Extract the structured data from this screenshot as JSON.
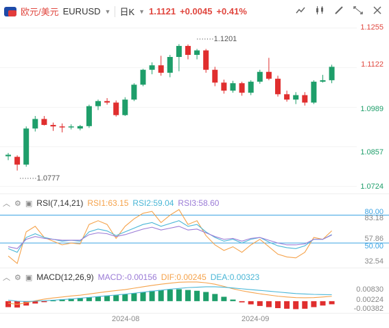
{
  "header": {
    "pair_cn": "欧元/美元",
    "symbol": "EURUSD",
    "timeframe": "日K",
    "price": "1.1121",
    "change": "+0.0045",
    "change_pct": "+0.41%",
    "tool_icons": [
      "line-chart-icon",
      "candle-type-icon",
      "draw-tool-icon",
      "expand-icon",
      "close-icon"
    ]
  },
  "price_axis": {
    "labels": [
      "1.1255",
      "1.1122",
      "1.0989",
      "1.0857",
      "1.0724"
    ],
    "current_tag": "1.1122",
    "high_label": "1.1201",
    "low_label": "1.0777"
  },
  "rsi": {
    "title": "RSI(7,14,21)",
    "rsi1": "RSI1:63.15",
    "rsi2": "RSI2:59.04",
    "rsi3": "RSI3:58.60",
    "axis": [
      "80.00",
      "83.18",
      "57.86",
      "50.00",
      "32.54"
    ]
  },
  "macd": {
    "title": "MACD(12,26,9)",
    "macd": "MACD:-0.00156",
    "dif": "DIF:0.00245",
    "dea": "DEA:0.00323",
    "axis": [
      "0.00830",
      "0.00224",
      "-0.00382"
    ]
  },
  "x_axis": [
    "2024-08",
    "2024-09"
  ],
  "colors": {
    "up": "#e02e2e",
    "down": "#1e9e6a",
    "rsi1": "#f5a24a",
    "rsi2": "#49b6d6",
    "rsi3": "#9a7ad6",
    "dif": "#f5a24a",
    "dea": "#49b6d6",
    "ref_line": "#3aa3e3"
  },
  "chart_data": [
    {
      "type": "candlestick",
      "series": [
        {
          "name": "EURUSD",
          "ohlc": [
            [
              1.0825,
              1.0836,
              1.0812,
              1.083
            ],
            [
              1.0823,
              1.0828,
              1.0777,
              1.0797
            ],
            [
              1.0797,
              1.0925,
              1.079,
              1.0918
            ],
            [
              1.0918,
              1.096,
              1.0908,
              1.095
            ],
            [
              1.095,
              1.096,
              1.0928,
              1.093
            ],
            [
              1.093,
              1.0938,
              1.091,
              1.0925
            ],
            [
              1.0925,
              1.0935,
              1.0905,
              1.0922
            ],
            [
              1.0922,
              1.0932,
              1.0915,
              1.0925
            ],
            [
              1.0918,
              1.093,
              1.0912,
              1.0926
            ],
            [
              1.0926,
              1.0998,
              1.092,
              1.0993
            ],
            [
              1.0993,
              1.1015,
              1.098,
              1.101
            ],
            [
              1.101,
              1.102,
              1.0998,
              1.1005
            ],
            [
              1.1005,
              1.1012,
              1.0958,
              1.0963
            ],
            [
              1.0963,
              1.1023,
              1.096,
              1.1015
            ],
            [
              1.1015,
              1.107,
              1.101,
              1.1065
            ],
            [
              1.1065,
              1.1118,
              1.106,
              1.1115
            ],
            [
              1.1115,
              1.114,
              1.11,
              1.113
            ],
            [
              1.113,
              1.1162,
              1.1095,
              1.1105
            ],
            [
              1.1105,
              1.1165,
              1.109,
              1.1158
            ],
            [
              1.1158,
              1.1201,
              1.111,
              1.1195
            ],
            [
              1.1195,
              1.12,
              1.115,
              1.1165
            ],
            [
              1.1165,
              1.1185,
              1.115,
              1.118
            ],
            [
              1.118,
              1.1185,
              1.1105,
              1.1115
            ],
            [
              1.1115,
              1.1125,
              1.106,
              1.1072
            ],
            [
              1.1072,
              1.1082,
              1.1035,
              1.1045
            ],
            [
              1.1045,
              1.1078,
              1.1038,
              1.107
            ],
            [
              1.107,
              1.1075,
              1.1028,
              1.1038
            ],
            [
              1.1038,
              1.108,
              1.103,
              1.1075
            ],
            [
              1.1075,
              1.1115,
              1.1068,
              1.1108
            ],
            [
              1.1108,
              1.1155,
              1.108,
              1.1085
            ],
            [
              1.1085,
              1.1095,
              1.1025,
              1.1033
            ],
            [
              1.1033,
              1.1045,
              1.1008,
              1.1015
            ],
            [
              1.1015,
              1.104,
              1.1,
              1.103
            ],
            [
              1.103,
              1.104,
              1.0995,
              1.1005
            ],
            [
              1.1005,
              1.108,
              1.1,
              1.1075
            ],
            [
              1.1075,
              1.1098,
              1.1072,
              1.108
            ],
            [
              1.108,
              1.1132,
              1.107,
              1.1125
            ]
          ]
        }
      ],
      "ylim": [
        1.07,
        1.128
      ]
    },
    {
      "type": "line",
      "series": [
        {
          "name": "RSI1",
          "values": [
            36,
            28,
            62,
            68,
            56,
            52,
            48,
            50,
            49,
            70,
            74,
            70,
            55,
            68,
            76,
            82,
            84,
            72,
            80,
            86,
            70,
            74,
            58,
            48,
            42,
            46,
            40,
            48,
            54,
            46,
            38,
            35,
            34,
            40,
            56,
            54,
            63.15
          ]
        },
        {
          "name": "RSI2",
          "values": [
            44,
            40,
            56,
            60,
            56,
            54,
            52,
            53,
            52,
            62,
            65,
            63,
            58,
            62,
            66,
            70,
            72,
            68,
            71,
            74,
            68,
            70,
            62,
            56,
            52,
            54,
            50,
            54,
            56,
            51,
            47,
            45,
            44,
            47,
            54,
            54,
            59.04
          ]
        },
        {
          "name": "RSI3",
          "values": [
            46,
            44,
            54,
            57,
            55,
            54,
            53,
            53,
            53,
            59,
            61,
            60,
            57,
            59,
            62,
            65,
            67,
            64,
            66,
            68,
            64,
            65,
            61,
            57,
            54,
            55,
            52,
            55,
            56,
            53,
            50,
            48,
            48,
            49,
            54,
            54,
            58.6
          ]
        }
      ],
      "ylim": [
        25,
        90
      ]
    },
    {
      "type": "bar",
      "series": [
        {
          "name": "MACD",
          "values": [
            -0.003,
            -0.0032,
            -0.0022,
            -0.0012,
            -0.0005,
            0.0003,
            0.0009,
            0.0013,
            0.0016,
            0.002,
            0.0024,
            0.0028,
            0.003,
            0.0034,
            0.004,
            0.0046,
            0.0052,
            0.0056,
            0.0058,
            0.006,
            0.0056,
            0.0052,
            0.0046,
            0.0036,
            0.0022,
            0.0008,
            -0.0006,
            -0.0016,
            -0.0024,
            -0.003,
            -0.0035,
            -0.0038,
            -0.004,
            -0.0038,
            -0.003,
            -0.0022,
            -0.00156
          ]
        },
        {
          "name": "DIF",
          "values": [
            -0.001,
            -0.0016,
            -0.0008,
            0.0002,
            0.001,
            0.0016,
            0.0021,
            0.0026,
            0.003,
            0.0036,
            0.0042,
            0.0048,
            0.0053,
            0.0058,
            0.0065,
            0.0072,
            0.0079,
            0.0085,
            0.009,
            0.0095,
            0.0096,
            0.0096,
            0.0092,
            0.0085,
            0.0074,
            0.0062,
            0.0052,
            0.0044,
            0.0037,
            0.0031,
            0.0025,
            0.0021,
            0.0018,
            0.0017,
            0.0018,
            0.0021,
            0.00245
          ]
        },
        {
          "name": "DEA",
          "values": [
            0.0005,
            0.0,
            -0.0002,
            0.0,
            0.0002,
            0.0005,
            0.0008,
            0.0011,
            0.0015,
            0.0019,
            0.0023,
            0.0027,
            0.0031,
            0.0035,
            0.004,
            0.0045,
            0.005,
            0.0055,
            0.006,
            0.0064,
            0.0068,
            0.007,
            0.0072,
            0.0072,
            0.007,
            0.0066,
            0.0062,
            0.0058,
            0.0054,
            0.005,
            0.0046,
            0.0042,
            0.0038,
            0.0036,
            0.0034,
            0.0033,
            0.00323
          ]
        }
      ],
      "ylim": [
        -0.0052,
        0.012
      ]
    }
  ]
}
